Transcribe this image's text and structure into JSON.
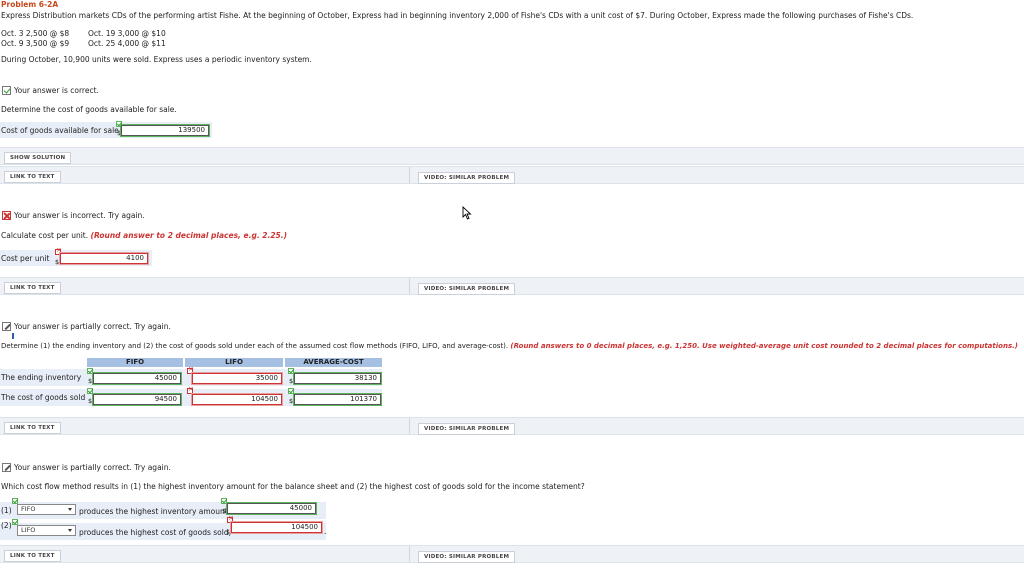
{
  "problem": {
    "title": "Problem 6-2A",
    "intro": "Express Distribution markets CDs of the performing artist Fishe. At the beginning of October, Express had in beginning inventory 2,000 of Fishe's CDs with a unit cost of $7. During October, Express made the following purchases of Fishe's CDs.",
    "purchases_col1": [
      "Oct. 3   2,500  @  $8",
      "Oct. 9   3,500  @  $9"
    ],
    "purchases_col2": [
      "Oct. 19   3,000  @  $10",
      "Oct. 25   4,000  @  $11"
    ],
    "sold_text": "During October, 10,900 units were sold. Express uses a periodic inventory system."
  },
  "part1": {
    "status": "Your answer is correct.",
    "question": "Determine the cost of goods available for sale.",
    "label": "Cost of goods available for sale",
    "currency": "$",
    "value": "139500",
    "show_solution": "SHOW SOLUTION",
    "link_text": "LINK TO TEXT",
    "video": "VIDEO: SIMILAR PROBLEM"
  },
  "part2": {
    "status": "Your answer is incorrect.  Try again.",
    "question": "Calculate cost per unit.",
    "hint": "(Round answer to 2 decimal places, e.g. 2.25.)",
    "label": "Cost per unit",
    "currency": "$",
    "value": "4100",
    "link_text": "LINK TO TEXT",
    "video": "VIDEO: SIMILAR PROBLEM"
  },
  "part3": {
    "status": "Your answer is partially correct.  Try again.",
    "question": "Determine (1) the ending inventory and (2) the cost of goods sold under each of the assumed cost flow methods (FIFO, LIFO, and average-cost).",
    "hint": "(Round answers to 0 decimal places, e.g. 1,250. Use weighted-average unit cost rounded to 2 decimal places for computations.)",
    "headers": [
      "FIFO",
      "LIFO",
      "AVERAGE-COST"
    ],
    "rows": [
      {
        "label": "The ending inventory",
        "values": [
          "45000",
          "35000",
          "38130"
        ]
      },
      {
        "label": "The cost of goods sold",
        "values": [
          "94500",
          "104500",
          "101370"
        ]
      }
    ],
    "currency": "$",
    "link_text": "LINK TO TEXT",
    "video": "VIDEO: SIMILAR PROBLEM"
  },
  "part4": {
    "status": "Your answer is partially correct.  Try again.",
    "question": "Which cost flow method results in (1) the highest inventory amount for the balance sheet and (2) the highest cost of goods sold for the income statement?",
    "row1_prefix": "(1)",
    "row1_select": "FIFO",
    "row1_text": "produces the highest inventory amount,",
    "row1_value": "45000",
    "row2_prefix": "(2)",
    "row2_select": "LIFO",
    "row2_text": "produces the highest cost of goods sold,",
    "row2_value": "104500",
    "currency": "$",
    "period": ".",
    "link_text": "LINK TO TEXT",
    "video": "VIDEO: SIMILAR PROBLEM"
  }
}
